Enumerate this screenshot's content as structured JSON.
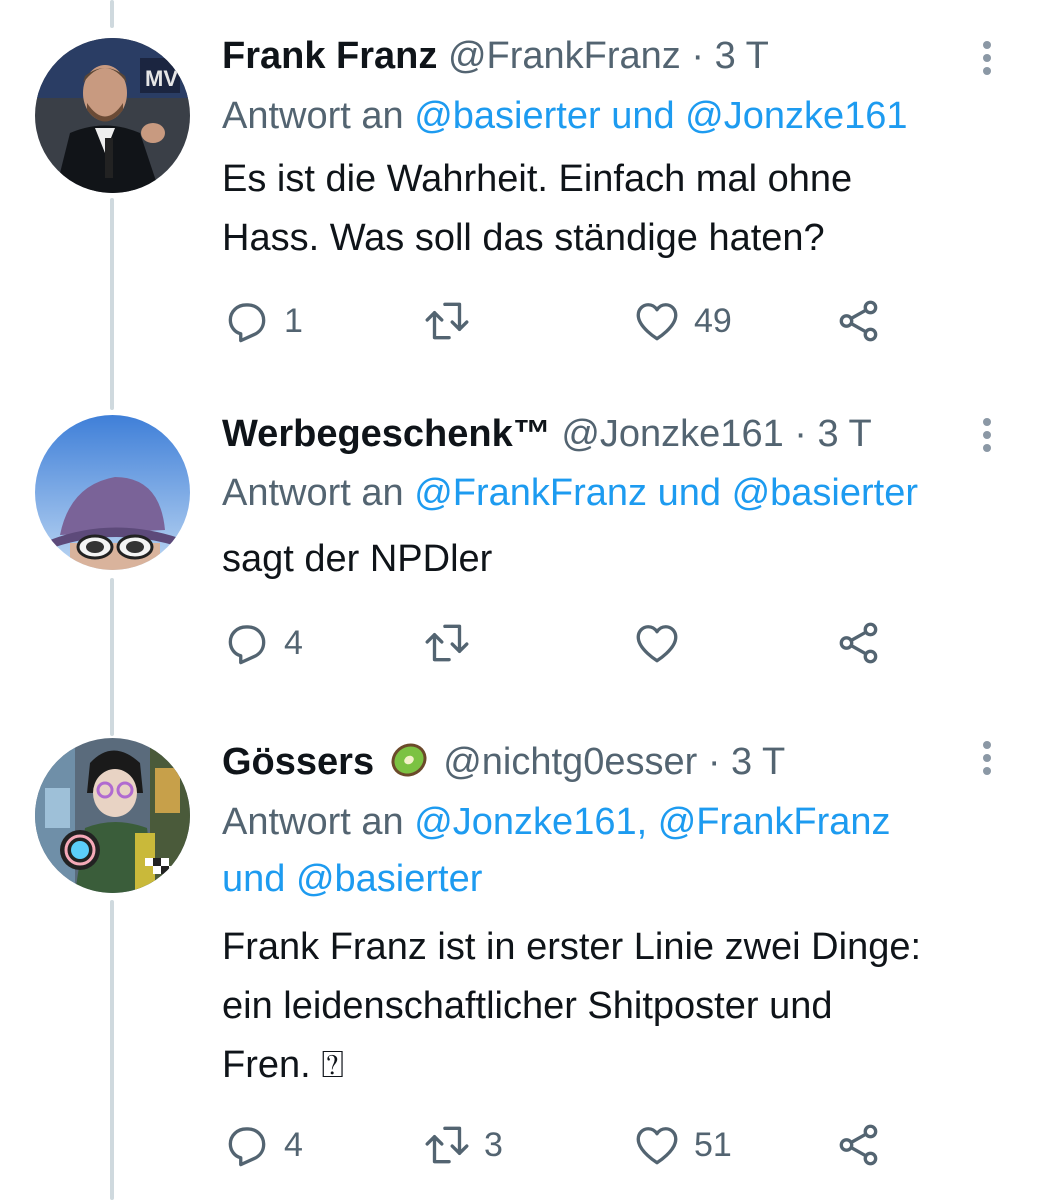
{
  "tweets": [
    {
      "name": "Frank Franz",
      "handle": "@FrankFranz",
      "time": "· 3 T",
      "reply_prefix": "Antwort an",
      "reply_line1": "@basierter und @Jonzke161",
      "reply_line2": "",
      "text_lines": [
        "Es ist die Wahrheit. Einfach mal ohne",
        "Hass. Was soll das ständige haten?"
      ],
      "reply_count": "1",
      "retweet_count": "",
      "like_count": "49"
    },
    {
      "name": "Werbegeschenk™",
      "handle": "@Jonzke161",
      "time": "· 3 T",
      "reply_prefix": "Antwort an",
      "reply_line1": "@FrankFranz und @basierter",
      "reply_line2": "",
      "text_lines": [
        "sagt der NPDler"
      ],
      "reply_count": "4",
      "retweet_count": "",
      "like_count": ""
    },
    {
      "name": "Gössers",
      "name_emoji": "kiwi-emoji",
      "handle": "@nichtg0esser",
      "time": "· 3 T",
      "reply_prefix": "Antwort an",
      "reply_line1": "@Jonzke161, @FrankFranz",
      "reply_line2": "und @basierter",
      "text_lines": [
        "Frank Franz ist in erster Linie zwei Dinge:",
        "ein leidenschaftlicher Shitposter und",
        "Fren. ⍰"
      ],
      "reply_count": "4",
      "retweet_count": "3",
      "like_count": "51"
    }
  ],
  "icons": {
    "reply": "reply-bubble-icon",
    "retweet": "retweet-icon",
    "like": "heart-icon",
    "share": "share-icon",
    "more": "more-vertical-icon"
  },
  "colors": {
    "link": "#1d9bf0",
    "muted": "#536471",
    "text": "#0f1419",
    "thread_line": "#cfd9de"
  }
}
